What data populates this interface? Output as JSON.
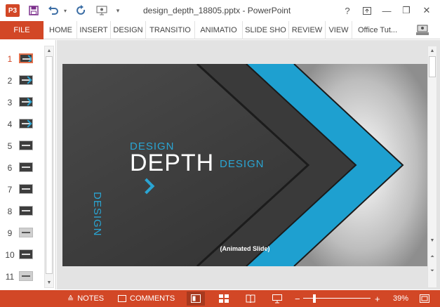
{
  "titlebar": {
    "app_icon": "P3",
    "title": "design_depth_18805.pptx - PowerPoint",
    "help": "?",
    "minimize": "—",
    "restore": "❐",
    "close": "✕",
    "save_icon": "save-icon",
    "undo_icon": "undo-icon",
    "redo_icon": "redo-icon"
  },
  "ribbon": {
    "file": "FILE",
    "tabs": [
      "HOME",
      "INSERT",
      "DESIGN",
      "TRANSITIO",
      "ANIMATIO",
      "SLIDE SHO",
      "REVIEW",
      "VIEW"
    ],
    "account": "Office Tut..."
  },
  "thumbnails": {
    "numbers": [
      "1",
      "2",
      "3",
      "4",
      "5",
      "6",
      "7",
      "8",
      "9",
      "10",
      "11"
    ],
    "active_index": 0
  },
  "slide": {
    "word_design_top": "DESIGN",
    "word_depth": "DEPTH",
    "word_design_right": "DESIGN",
    "word_design_vertical": "DESIGN",
    "caption": "(Animated Slide)",
    "accent_color": "#2aa5d3",
    "background_color": "#3a3a3a"
  },
  "statusbar": {
    "notes": "NOTES",
    "comments": "COMMENTS",
    "zoom_minus": "−",
    "zoom_plus": "+",
    "zoom_level": "39%",
    "zoom_fraction": 0.39,
    "color": "#d24726"
  }
}
